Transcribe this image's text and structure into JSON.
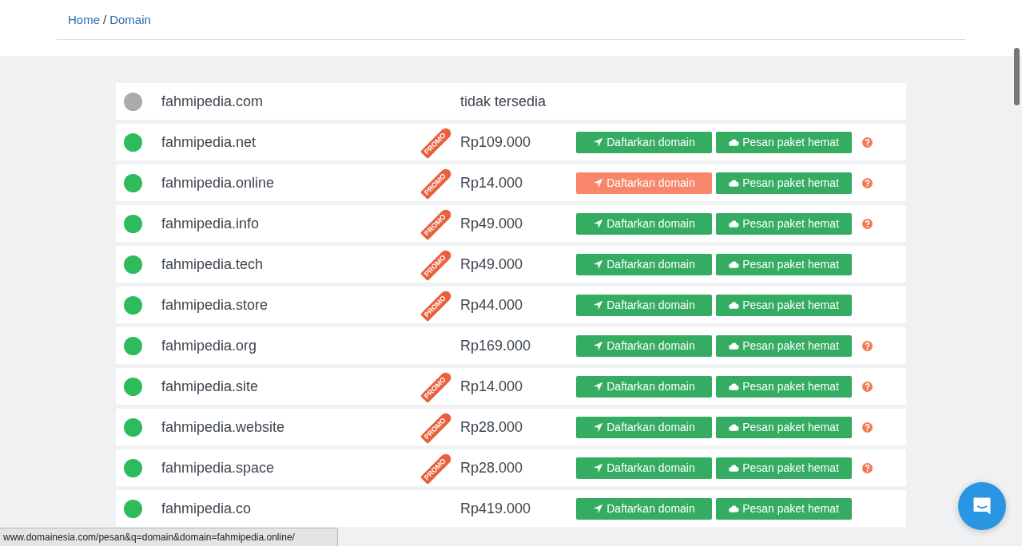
{
  "breadcrumb": [
    {
      "label": "Home"
    },
    {
      "label": "Domain",
      "separator": "/"
    }
  ],
  "domains": [
    {
      "name": "fahmipedia.com",
      "available": false,
      "price": "tidak tersedia",
      "help": false
    },
    {
      "name": "fahmipedia.net",
      "available": true,
      "promo_tag": "PROMO",
      "price": "Rp109.000",
      "register": {
        "label": "Daftarkan domain",
        "hovered": false
      },
      "bundle": "Pesan paket hemat",
      "help": true
    },
    {
      "name": "fahmipedia.online",
      "available": true,
      "promo_tag": "PROMO",
      "price": "Rp14.000",
      "register": {
        "label": "Daftarkan domain",
        "hovered": true
      },
      "bundle": "Pesan paket hemat",
      "help": true
    },
    {
      "name": "fahmipedia.info",
      "available": true,
      "promo_tag": "PROMO",
      "price": "Rp49.000",
      "register": {
        "label": "Daftarkan domain",
        "hovered": false
      },
      "bundle": "Pesan paket hemat",
      "help": true
    },
    {
      "name": "fahmipedia.tech",
      "available": true,
      "promo_tag": "PROMO",
      "price": "Rp49.000",
      "register": {
        "label": "Daftarkan domain",
        "hovered": false
      },
      "bundle": "Pesan paket hemat",
      "help": false
    },
    {
      "name": "fahmipedia.store",
      "available": true,
      "promo_tag": "PROMO",
      "price": "Rp44.000",
      "register": {
        "label": "Daftarkan domain",
        "hovered": false
      },
      "bundle": "Pesan paket hemat",
      "help": false
    },
    {
      "name": "fahmipedia.org",
      "available": true,
      "price": "Rp169.000",
      "register": {
        "label": "Daftarkan domain",
        "hovered": false
      },
      "bundle": "Pesan paket hemat",
      "help": true
    },
    {
      "name": "fahmipedia.site",
      "available": true,
      "promo_tag": "PROMO",
      "price": "Rp14.000",
      "register": {
        "label": "Daftarkan domain",
        "hovered": false
      },
      "bundle": "Pesan paket hemat",
      "help": true
    },
    {
      "name": "fahmipedia.website",
      "available": true,
      "promo_tag": "PROMO",
      "price": "Rp28.000",
      "register": {
        "label": "Daftarkan domain",
        "hovered": false
      },
      "bundle": "Pesan paket hemat",
      "help": true
    },
    {
      "name": "fahmipedia.space",
      "available": true,
      "promo_tag": "PROMO",
      "price": "Rp28.000",
      "register": {
        "label": "Daftarkan domain",
        "hovered": false
      },
      "bundle": "Pesan paket hemat",
      "help": true
    },
    {
      "name": "fahmipedia.co",
      "available": true,
      "price": "Rp419.000",
      "register": {
        "label": "Daftarkan domain",
        "hovered": false
      },
      "bundle": "Pesan paket hemat",
      "help": false
    }
  ],
  "status_url": "www.domainesia.com/pesan&q=domain&domain=fahmipedia.online/"
}
